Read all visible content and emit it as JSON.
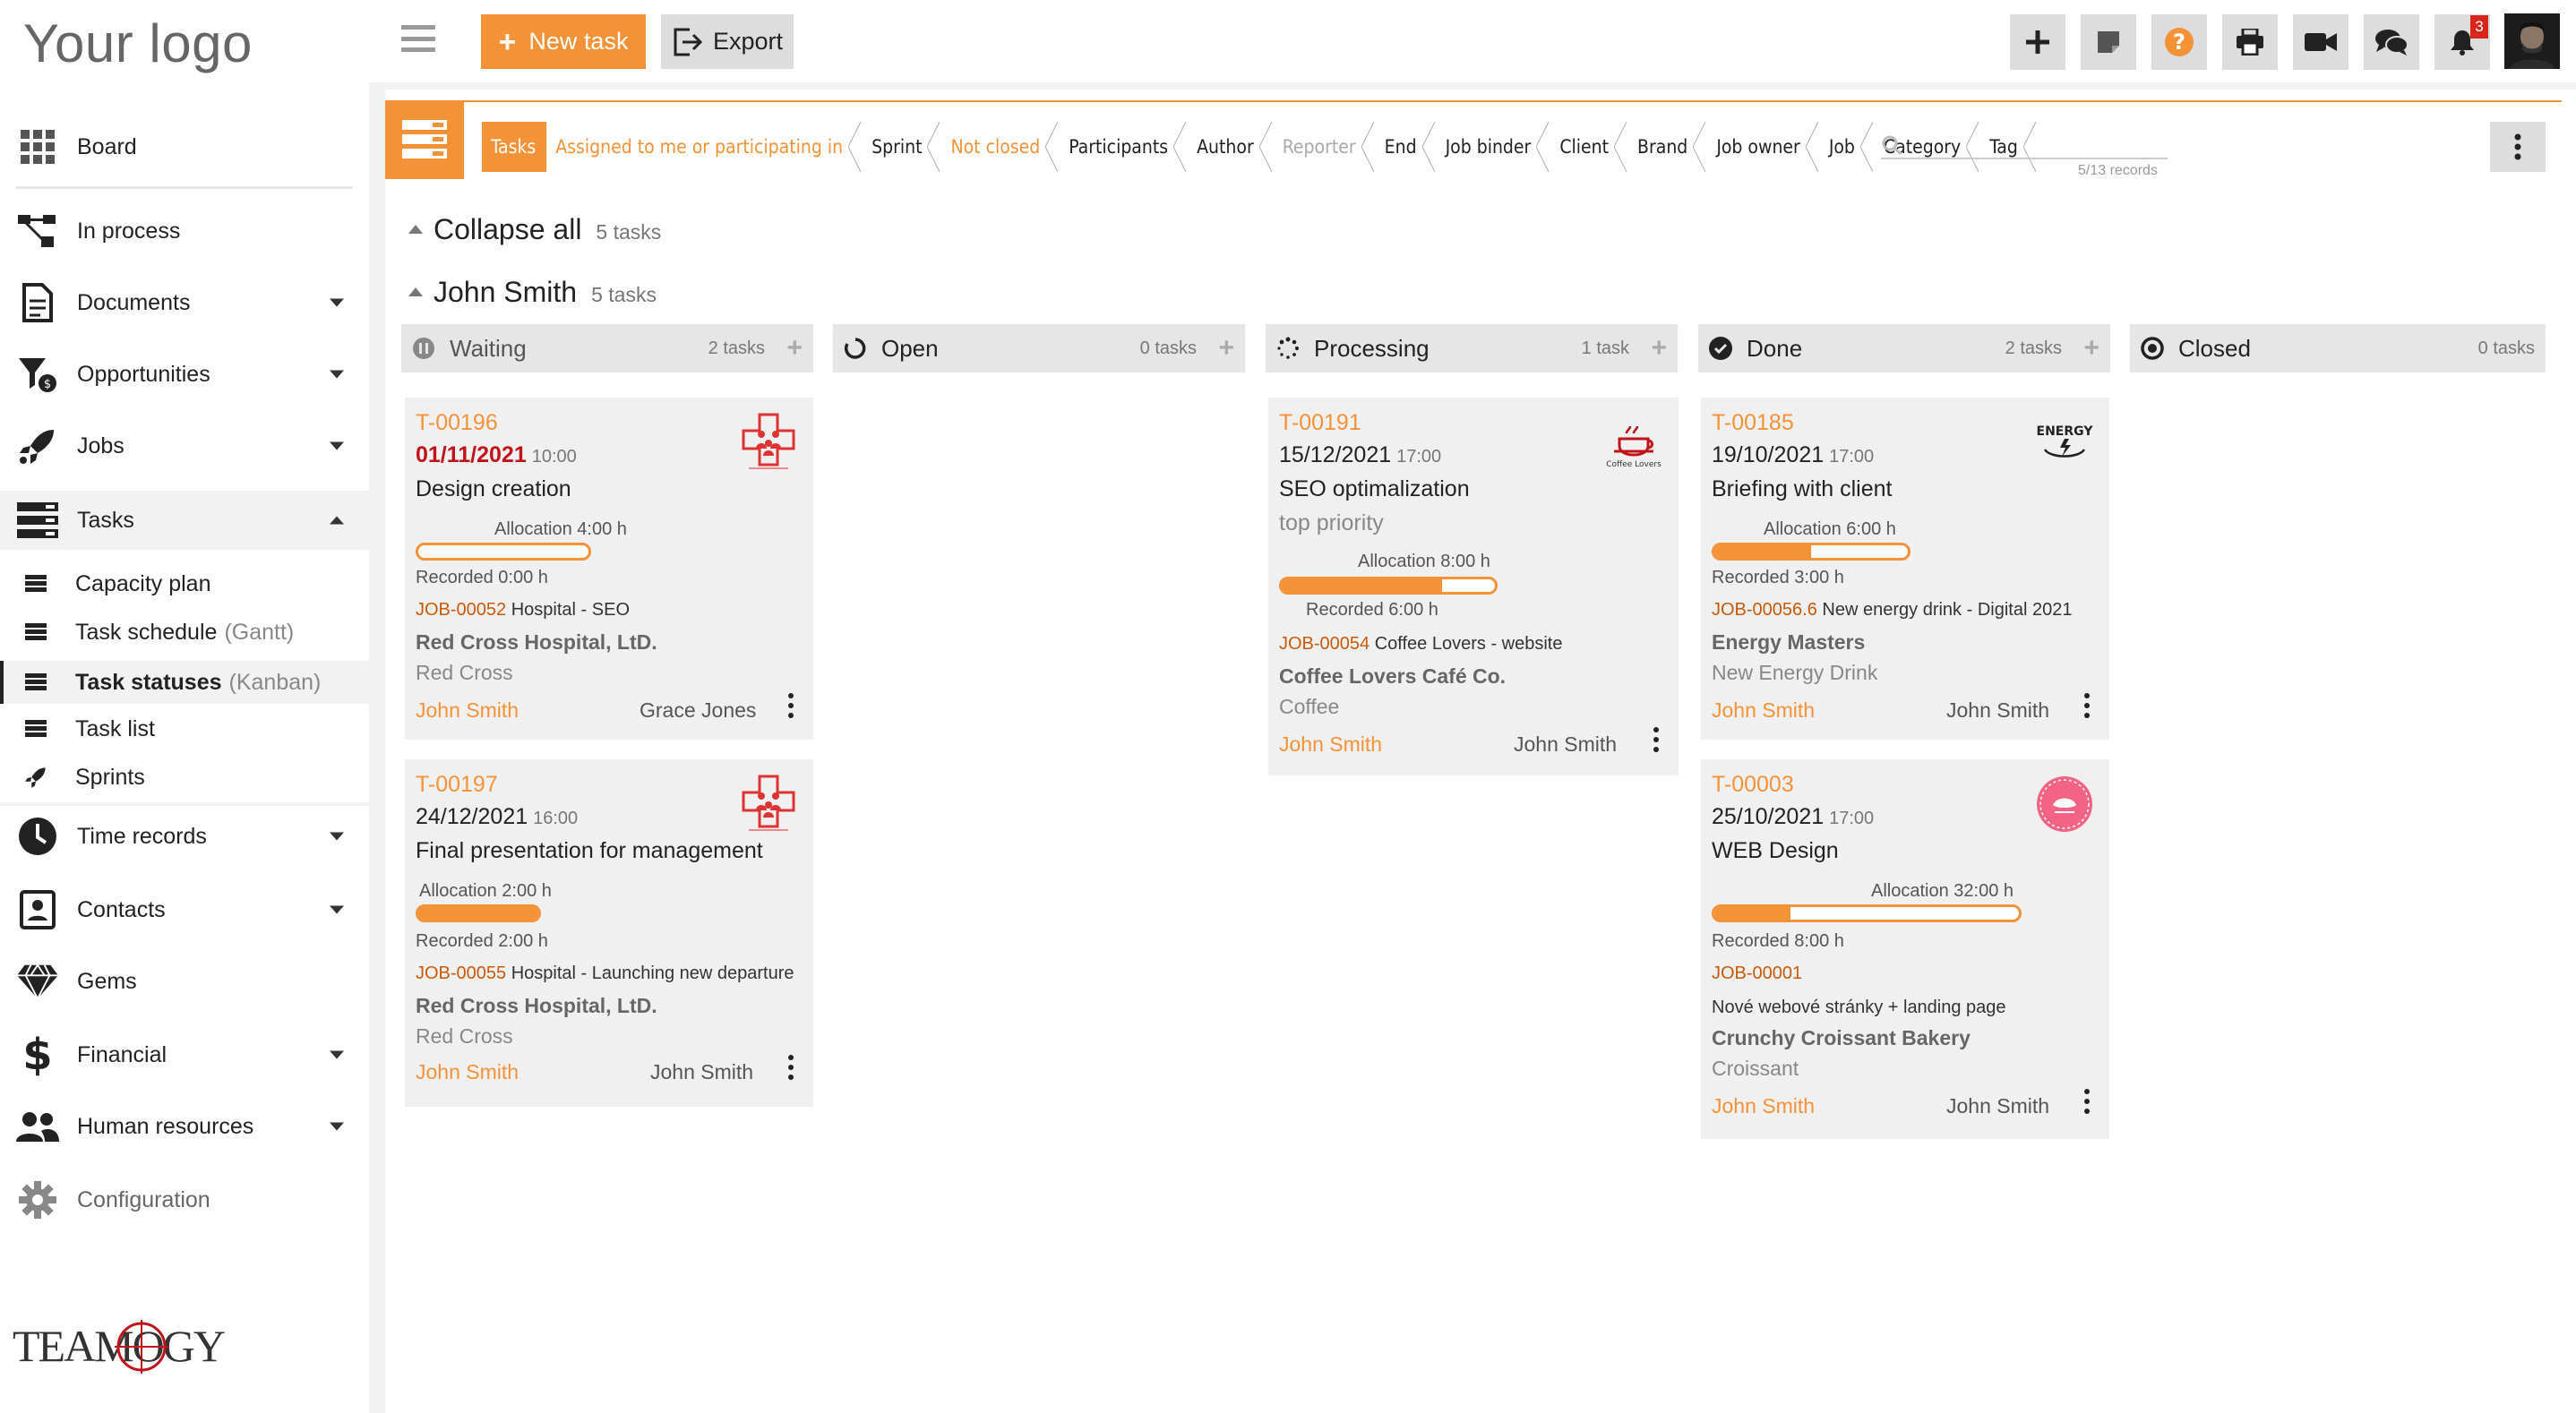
{
  "brand": {
    "logo_text": "Your logo",
    "footer_logo_text": "TEAMOGY",
    "accent": "#f39237"
  },
  "toolbar": {
    "new_task": "New task",
    "export": "Export",
    "notifications_count": "3"
  },
  "sidebar": {
    "items": [
      {
        "label": "Board",
        "icon": "grid-icon"
      },
      {
        "label": "In process",
        "icon": "process-icon"
      },
      {
        "label": "Documents",
        "icon": "document-icon"
      },
      {
        "label": "Opportunities",
        "icon": "opportunities-icon"
      },
      {
        "label": "Jobs",
        "icon": "rocket-icon"
      },
      {
        "label": "Tasks",
        "icon": "tasks-icon"
      },
      {
        "label": "Time records",
        "icon": "clock-icon"
      },
      {
        "label": "Contacts",
        "icon": "contacts-icon"
      },
      {
        "label": "Gems",
        "icon": "diamond-icon"
      },
      {
        "label": "Financial",
        "icon": "dollar-icon"
      },
      {
        "label": "Human resources",
        "icon": "people-icon"
      },
      {
        "label": "Configuration",
        "icon": "gear-icon"
      }
    ],
    "tasks_sub": [
      {
        "label": "Capacity plan",
        "suffix": ""
      },
      {
        "label": "Task schedule",
        "suffix": "(Gantt)"
      },
      {
        "label": "Task statuses",
        "suffix": "(Kanban)"
      },
      {
        "label": "Task list",
        "suffix": ""
      },
      {
        "label": "Sprints",
        "suffix": ""
      }
    ]
  },
  "filters": {
    "crumbs": [
      "Tasks",
      "Assigned to me or participating in",
      "Sprint",
      "Not closed",
      "Participants",
      "Author",
      "Reporter",
      "End",
      "Job binder",
      "Client",
      "Brand",
      "Job owner",
      "Job",
      "Category",
      "Tag"
    ],
    "records": "5/13 records"
  },
  "groups": {
    "collapse_all": "Collapse all",
    "collapse_count": "5 tasks",
    "person": "John Smith",
    "person_count": "5 tasks"
  },
  "columns": [
    {
      "name": "Waiting",
      "count": "2 tasks"
    },
    {
      "name": "Open",
      "count": "0 tasks"
    },
    {
      "name": "Processing",
      "count": "1 task"
    },
    {
      "name": "Done",
      "count": "2 tasks"
    },
    {
      "name": "Closed",
      "count": "0 tasks"
    }
  ],
  "cards": {
    "c196": {
      "id": "T-00196",
      "date": "01/11/2021",
      "time": "10:00",
      "title": "Design creation",
      "allocation": "Allocation 4:00 h",
      "alloc_pct": 0,
      "recorded": "Recorded 0:00 h",
      "job_id": "JOB-00052",
      "job_name": "Hospital - SEO",
      "client": "Red Cross Hospital, LtD.",
      "brand": "Red Cross",
      "owner": "John Smith",
      "assignee": "Grace Jones"
    },
    "c197": {
      "id": "T-00197",
      "date": "24/12/2021",
      "time": "16:00",
      "title": "Final presentation for management",
      "allocation": "Allocation 2:00 h",
      "alloc_pct": 100,
      "recorded": "Recorded 2:00 h",
      "job_id": "JOB-00055",
      "job_name": "Hospital - Launching new departure",
      "client": "Red Cross Hospital, LtD.",
      "brand": "Red Cross",
      "owner": "John Smith",
      "assignee": "John Smith"
    },
    "c191": {
      "id": "T-00191",
      "date": "15/12/2021",
      "time": "17:00",
      "title": "SEO optimalization",
      "priority": "top priority",
      "allocation": "Allocation 8:00 h",
      "alloc_pct": 75,
      "recorded": "Recorded 6:00 h",
      "job_id": "JOB-00054",
      "job_name": "Coffee Lovers - website",
      "client": "Coffee Lovers Café Co.",
      "brand": "Coffee",
      "owner": "John Smith",
      "assignee": "John Smith",
      "logo_text": "Coffee Lovers"
    },
    "c185": {
      "id": "T-00185",
      "date": "19/10/2021",
      "time": "17:00",
      "title": "Briefing with client",
      "allocation": "Allocation 6:00 h",
      "alloc_pct": 50,
      "recorded": "Recorded 3:00 h",
      "job_id": "JOB-00056.6",
      "job_name": "New energy drink - Digital 2021",
      "client": "Energy Masters",
      "brand": "New Energy Drink",
      "owner": "John Smith",
      "assignee": "John Smith",
      "logo_text": "ENERGY"
    },
    "c003": {
      "id": "T-00003",
      "date": "25/10/2021",
      "time": "17:00",
      "title": "WEB Design",
      "allocation": "Allocation 32:00 h",
      "alloc_pct": 25,
      "recorded": "Recorded 8:00 h",
      "job_id": "JOB-00001",
      "job_name": "Nové webové stránky + landing page",
      "client": "Crunchy Croissant Bakery",
      "brand": "Croissant",
      "owner": "John Smith",
      "assignee": "John Smith"
    }
  }
}
